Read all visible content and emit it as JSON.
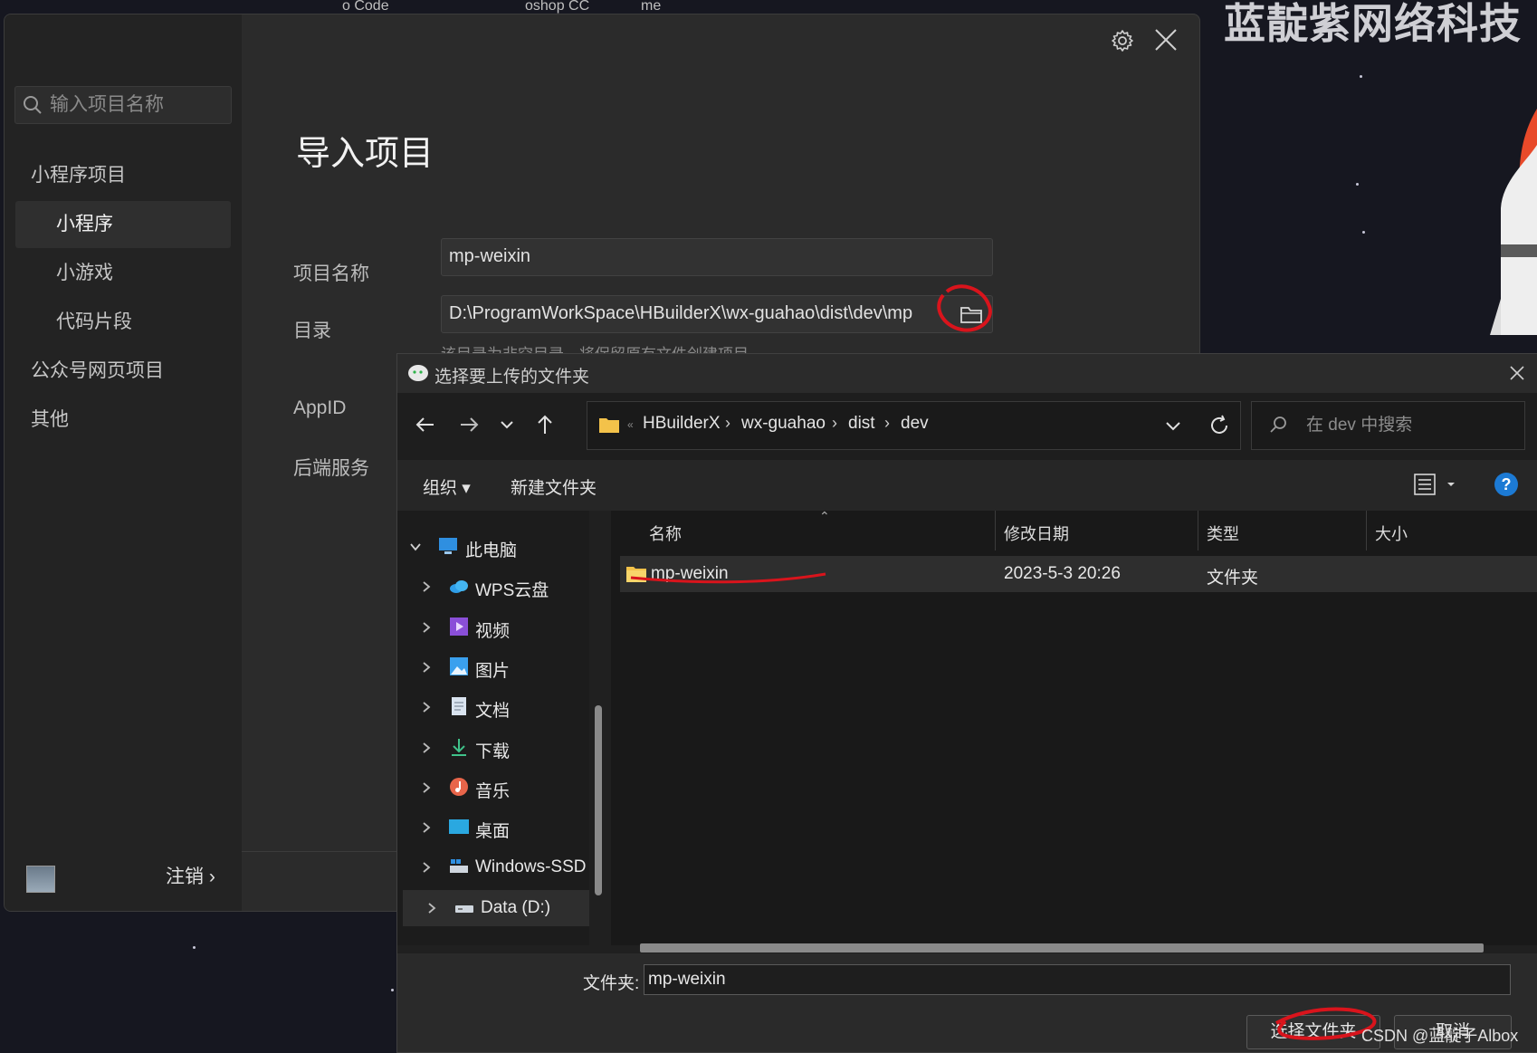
{
  "background": {
    "top_strip": [
      "o Code",
      "oshop CC",
      "me"
    ],
    "brand_text": "蓝靛紫网络科技"
  },
  "devtools": {
    "search_placeholder": "输入项目名称",
    "sidebar": {
      "items": [
        {
          "label": "小程序项目",
          "kind": "group"
        },
        {
          "label": "小程序",
          "kind": "sub",
          "active": true
        },
        {
          "label": "小游戏",
          "kind": "sub"
        },
        {
          "label": "代码片段",
          "kind": "sub"
        },
        {
          "label": "公众号网页项目",
          "kind": "group"
        },
        {
          "label": "其他",
          "kind": "group"
        }
      ],
      "logout_label": "注销 ›"
    },
    "title": "导入项目",
    "form": {
      "name_label": "项目名称",
      "name_value": "mp-weixin",
      "dir_label": "目录",
      "dir_value": "D:\\ProgramWorkSpace\\HBuilderX\\wx-guahao\\dist\\dev\\mp",
      "dir_hint": "该目录为非空目录，将保留原有文件创建项目",
      "appid_label": "AppID",
      "backend_label": "后端服务"
    }
  },
  "dialog": {
    "title": "选择要上传的文件夹",
    "breadcrumb": [
      "HBuilderX",
      "wx-guahao",
      "dist",
      "dev"
    ],
    "search_placeholder": "在 dev 中搜索",
    "toolbar": {
      "organize": "组织 ▾",
      "new_folder": "新建文件夹",
      "help": "?"
    },
    "tree": [
      {
        "label": "此电脑",
        "icon": "computer-icon",
        "root": true
      },
      {
        "label": "WPS云盘",
        "icon": "cloud-icon"
      },
      {
        "label": "视频",
        "icon": "video-icon"
      },
      {
        "label": "图片",
        "icon": "picture-icon"
      },
      {
        "label": "文档",
        "icon": "document-icon"
      },
      {
        "label": "下载",
        "icon": "download-icon"
      },
      {
        "label": "音乐",
        "icon": "music-icon"
      },
      {
        "label": "桌面",
        "icon": "desktop-icon"
      },
      {
        "label": "Windows-SSD",
        "icon": "drive-c-icon"
      },
      {
        "label": "Data (D:)",
        "icon": "drive-icon",
        "selected": true
      }
    ],
    "columns": {
      "name": "名称",
      "modified": "修改日期",
      "type": "类型",
      "size": "大小"
    },
    "files": [
      {
        "name": "mp-weixin",
        "modified": "2023-5-3 20:26",
        "type": "文件夹",
        "size": ""
      }
    ],
    "folder_label": "文件夹:",
    "folder_value": "mp-weixin",
    "select_button": "选择文件夹",
    "cancel_button": "取消"
  },
  "watermark": "CSDN @蓝靛子Albox",
  "colors": {
    "annotation_red": "#d9141c",
    "help_blue": "#1c7ad4",
    "folder_yellow": "#f3c24a"
  }
}
